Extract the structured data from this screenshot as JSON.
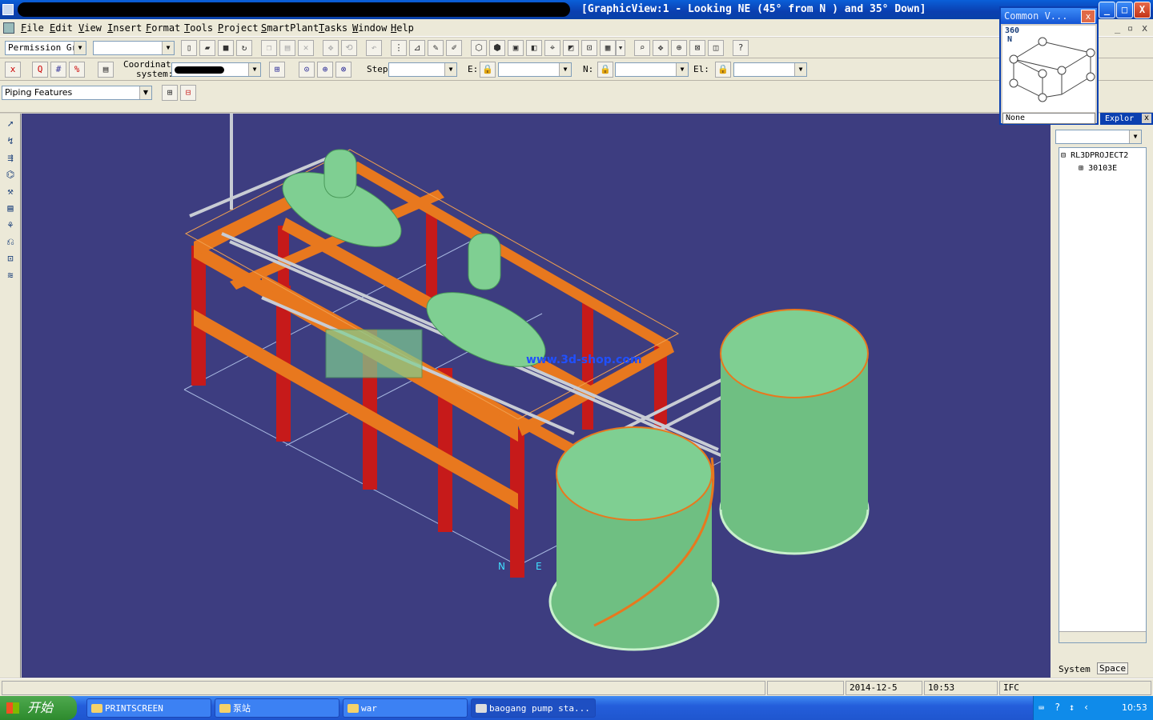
{
  "window": {
    "title": "[GraphicView:1 - Looking NE (45° from N ) and 35° Down]",
    "buttons": {
      "minimize": "_",
      "maximize": "□",
      "close": "X"
    }
  },
  "menu": [
    "File",
    "Edit",
    "View",
    "Insert",
    "Format",
    "Tools",
    "Project",
    "SmartPlant",
    "Tasks",
    "Window",
    "Help"
  ],
  "toolbar1": {
    "permission_group": "Permission Gro",
    "second_combo": ""
  },
  "toolbar2": {
    "coordinate_label_1": "Coordinate",
    "coordinate_label_2": "system:",
    "step_label": "Step:",
    "e_label": "E:",
    "n_label": "N:",
    "el_label": "El:"
  },
  "toolbar3": {
    "task_combo": "Piping Features"
  },
  "common_views": {
    "title": "Common V...",
    "angle_label": "360",
    "north_label": "N",
    "selection": "None"
  },
  "explorer": {
    "title": "Explor",
    "tree_root": "RL3DPROJECT2",
    "tree_child": "30103E",
    "tab_system": "System",
    "tab_space": "Space"
  },
  "view": {
    "watermark": "www.3d-shop.com",
    "axis_n": "N",
    "axis_e": "E"
  },
  "status": {
    "date": "2014-12-5",
    "time": "10:53",
    "mode": "IFC"
  },
  "taskbar": {
    "start": "开始",
    "tasks": [
      "PRINTSCREEN",
      "泵站",
      "war",
      "baogang pump sta..."
    ],
    "clock": "10:53"
  }
}
